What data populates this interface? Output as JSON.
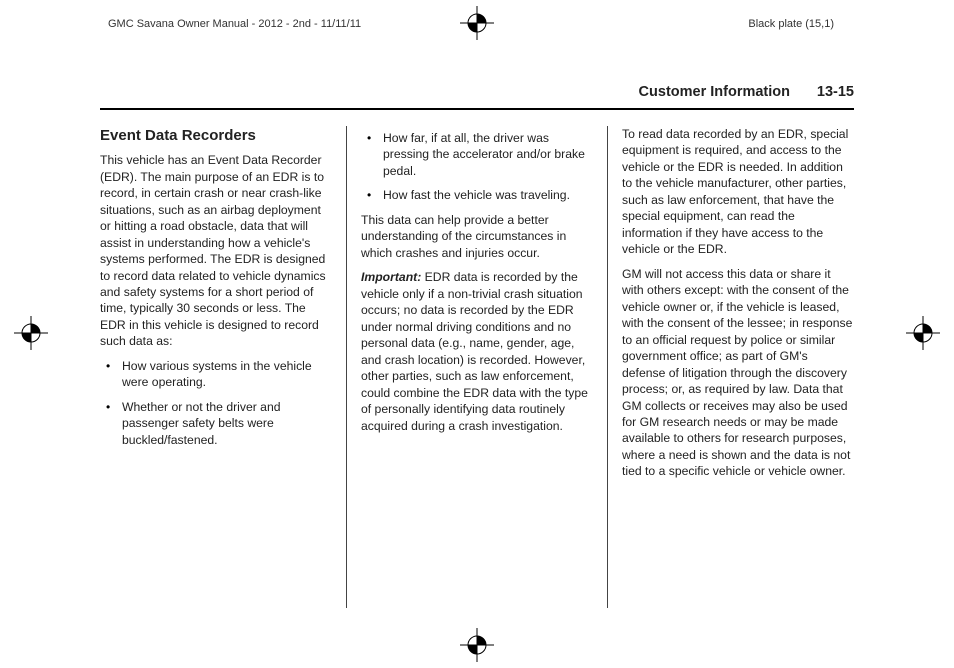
{
  "printer": {
    "left": "GMC Savana Owner Manual - 2012 - 2nd - 11/11/11",
    "right": "Black plate (15,1)"
  },
  "runhead": {
    "title": "Customer Information",
    "page": "13-15"
  },
  "col1": {
    "heading": "Event Data Recorders",
    "intro": "This vehicle has an Event Data Recorder (EDR). The main purpose of an EDR is to record, in certain crash or near crash-like situations, such as an airbag deployment or hitting a road obstacle, data that will assist in understanding how a vehicle's systems performed. The EDR is designed to record data related to vehicle dynamics and safety systems for a short period of time, typically 30 seconds or less. The EDR in this vehicle is designed to record such data as:",
    "bullets": [
      "How various systems in the vehicle were operating.",
      "Whether or not the driver and passenger safety belts were buckled/fastened."
    ]
  },
  "col2": {
    "bullets": [
      "How far, if at all, the driver was pressing the accelerator and/or brake pedal.",
      "How fast the vehicle was traveling."
    ],
    "p1": "This data can help provide a better understanding of the circumstances in which crashes and injuries occur.",
    "important_label": "Important:",
    "important_body": "EDR data is recorded by the vehicle only if a non-trivial crash situation occurs; no data is recorded by the EDR under normal driving conditions and no personal data (e.g., name, gender, age, and crash location) is recorded. However, other parties, such as law enforcement, could combine the EDR data with the type of personally identifying data routinely acquired during a crash investigation."
  },
  "col3": {
    "p1": "To read data recorded by an EDR, special equipment is required, and access to the vehicle or the EDR is needed. In addition to the vehicle manufacturer, other parties, such as law enforcement, that have the special equipment, can read the information if they have access to the vehicle or the EDR.",
    "p2": "GM will not access this data or share it with others except: with the consent of the vehicle owner or, if the vehicle is leased, with the consent of the lessee; in response to an official request by police or similar government office; as part of GM's defense of litigation through the discovery process; or, as required by law. Data that GM collects or receives may also be used for GM research needs or may be made available to others for research purposes, where a need is shown and the data is not tied to a specific vehicle or vehicle owner."
  }
}
